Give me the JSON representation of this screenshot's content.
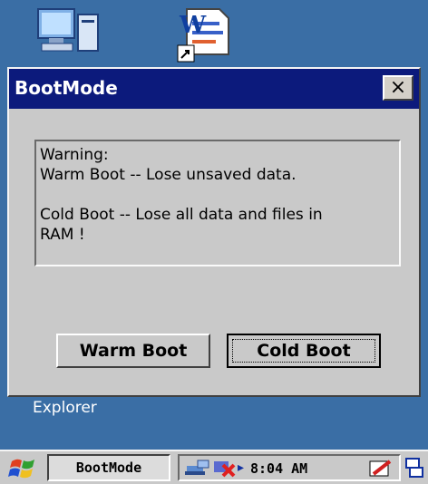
{
  "desktop": {
    "icons": [
      {
        "name": "my-computer-icon"
      },
      {
        "name": "wordpad-shortcut-icon"
      }
    ],
    "explorer_label": "Explorer"
  },
  "dialog": {
    "title": "BootMode",
    "close_glyph": "×",
    "message": {
      "line1": "Warning:",
      "line2": "Warm Boot -- Lose unsaved data.",
      "line3": "Cold Boot -- Lose all data and files in",
      "line4": "RAM !"
    },
    "buttons": {
      "warm_label": "Warm Boot",
      "cold_label": "Cold Boot"
    }
  },
  "taskbar": {
    "task_label": "BootMode",
    "clock": "8:04 AM",
    "tray_arrow": "▸"
  },
  "colors": {
    "desktop": "#3a6ea5",
    "titlebar": "#0c1a7c",
    "dialog": "#c9c9c9"
  }
}
